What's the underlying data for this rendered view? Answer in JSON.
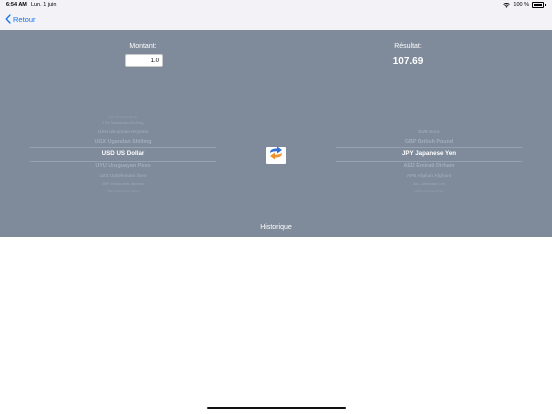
{
  "status_bar": {
    "time": "6:54 AM",
    "date": "Lun. 1 juin",
    "battery": "100 %"
  },
  "navbar": {
    "back_label": "Retour"
  },
  "converter": {
    "amount_label": "Montant:",
    "amount_value": "1.0",
    "result_label": "Résultat:",
    "result_value": "107.69",
    "history_label": "Historique"
  },
  "from_picker": {
    "items": [
      "PAB Panamian Balboa",
      "TOP Tongan Pa'anga",
      "TMT Turkmen Manat",
      "TZS Tanzanian Shilling",
      "UAH Ukrainian Hryvnia",
      "UGX Ugandan Shilling",
      "USD US Dollar",
      "UYU Uruguayan Peso",
      "UZS Uzbekistani Som",
      "VEF Venezuelan Bolivar",
      "VND Vietnamese Dong",
      "WST Samoan Tala"
    ],
    "selected_index": 6
  },
  "to_picker": {
    "items": [
      "EUR Euro",
      "GBP British Pound",
      "JPY Japanese Yen",
      "AED Emirati Dirham",
      "AFN Afghan Afghani",
      "ALL Albanian Lek",
      "AMD Armenian Dram",
      "ANG Dutch Guilder"
    ],
    "selected_index": 2
  },
  "colors": {
    "panel_background": "#7f8a9a",
    "accent": "#1a73e8",
    "swap_icon_blue": "#2f6fd6",
    "swap_icon_orange": "#f0932b"
  },
  "icons": {
    "back": "chevron-left-icon",
    "swap": "swap-arrows-icon",
    "wifi": "wifi-icon",
    "battery": "battery-icon"
  }
}
